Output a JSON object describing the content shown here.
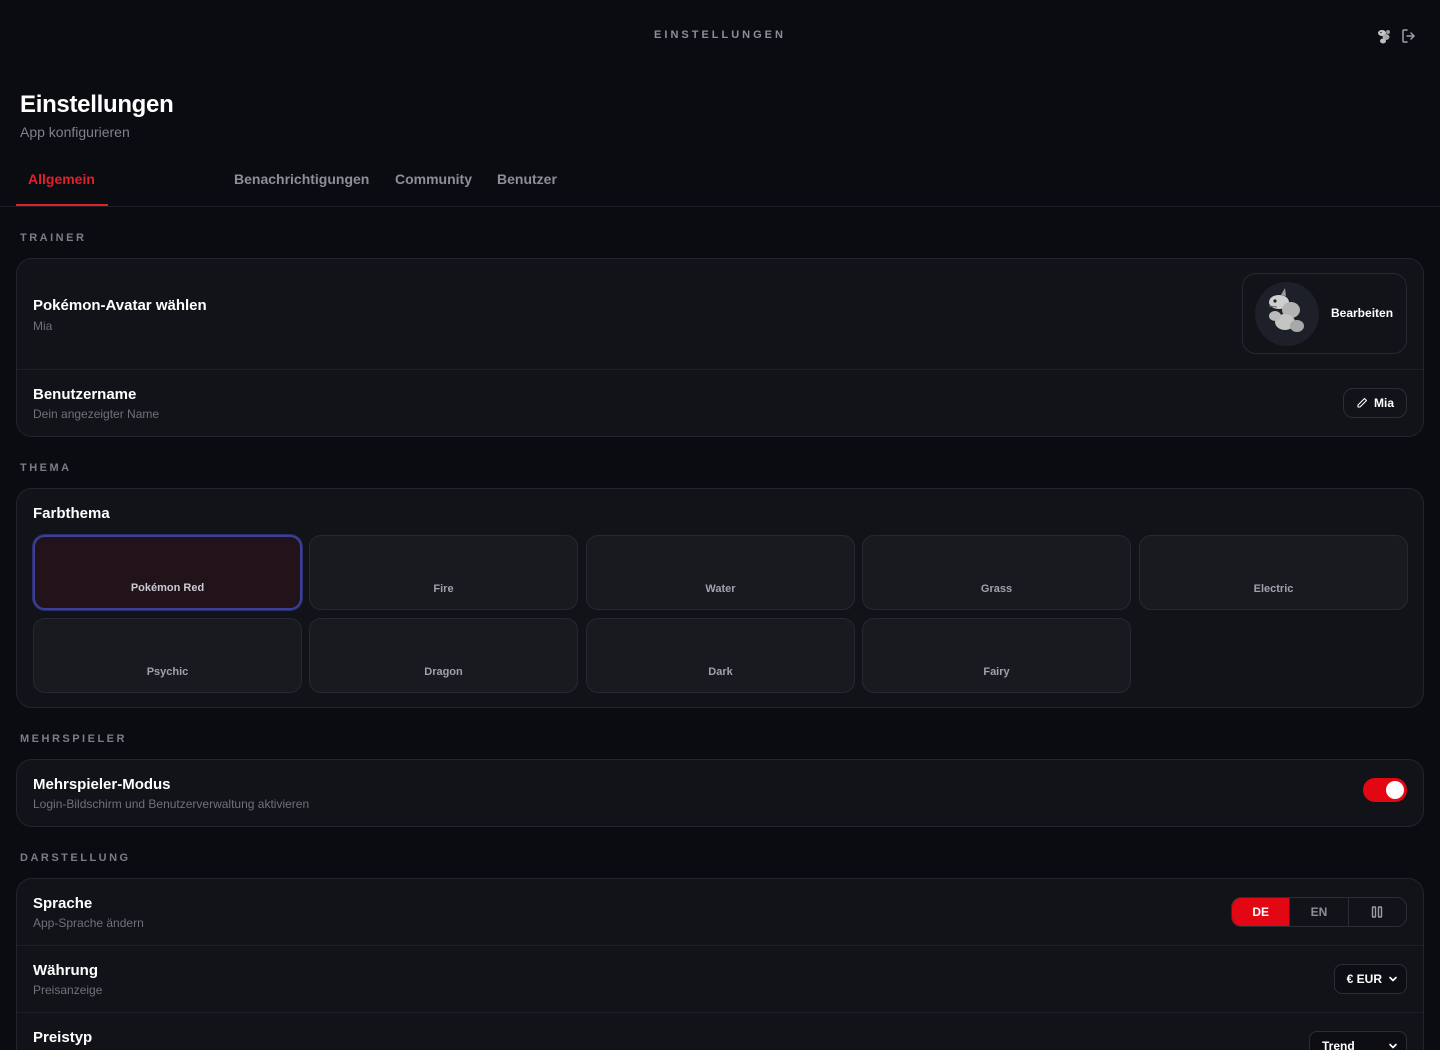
{
  "topbar": {
    "title": "EINSTELLUNGEN",
    "icons": [
      "onix-avatar-icon",
      "logout-icon"
    ]
  },
  "header": {
    "title": "Einstellungen",
    "subtitle": "App konfigurieren"
  },
  "tabs": [
    {
      "label": "Allgemein",
      "active": true
    },
    {
      "label": "Benachrichtigungen",
      "active": false
    },
    {
      "label": "Community",
      "active": false
    },
    {
      "label": "Benutzer",
      "active": false
    }
  ],
  "sections": {
    "trainer": "TRAINER",
    "thema": "THEMA",
    "mehrspieler": "MEHRSPIELER",
    "darstellung": "DARSTELLUNG"
  },
  "trainer": {
    "avatar_title": "Pokémon-Avatar wählen",
    "avatar_sub": "Mia",
    "avatar_button": "Bearbeiten",
    "username_title": "Benutzername",
    "username_sub": "Dein angezeigter Name",
    "username_value": "Mia"
  },
  "theme": {
    "title": "Farbthema",
    "options": [
      "Pokémon Red",
      "Fire",
      "Water",
      "Grass",
      "Electric",
      "Psychic",
      "Dragon",
      "Dark",
      "Fairy"
    ],
    "selected": "Pokémon Red"
  },
  "multiplayer": {
    "title": "Mehrspieler-Modus",
    "sub": "Login-Bildschirm und Benutzerverwaltung aktivieren",
    "enabled": true
  },
  "display": {
    "language_title": "Sprache",
    "language_sub": "App-Sprache ändern",
    "language_options": [
      "DE",
      "EN"
    ],
    "language_selected": "DE",
    "currency_title": "Währung",
    "currency_sub": "Preisanzeige",
    "currency_value": "€ EUR",
    "price_type_title": "Preistyp",
    "price_type_value": "Trend"
  },
  "colors": {
    "accent": "#e30613",
    "background": "#0b0c11",
    "card": "#111318",
    "selected_border": "#3a3f9a"
  }
}
